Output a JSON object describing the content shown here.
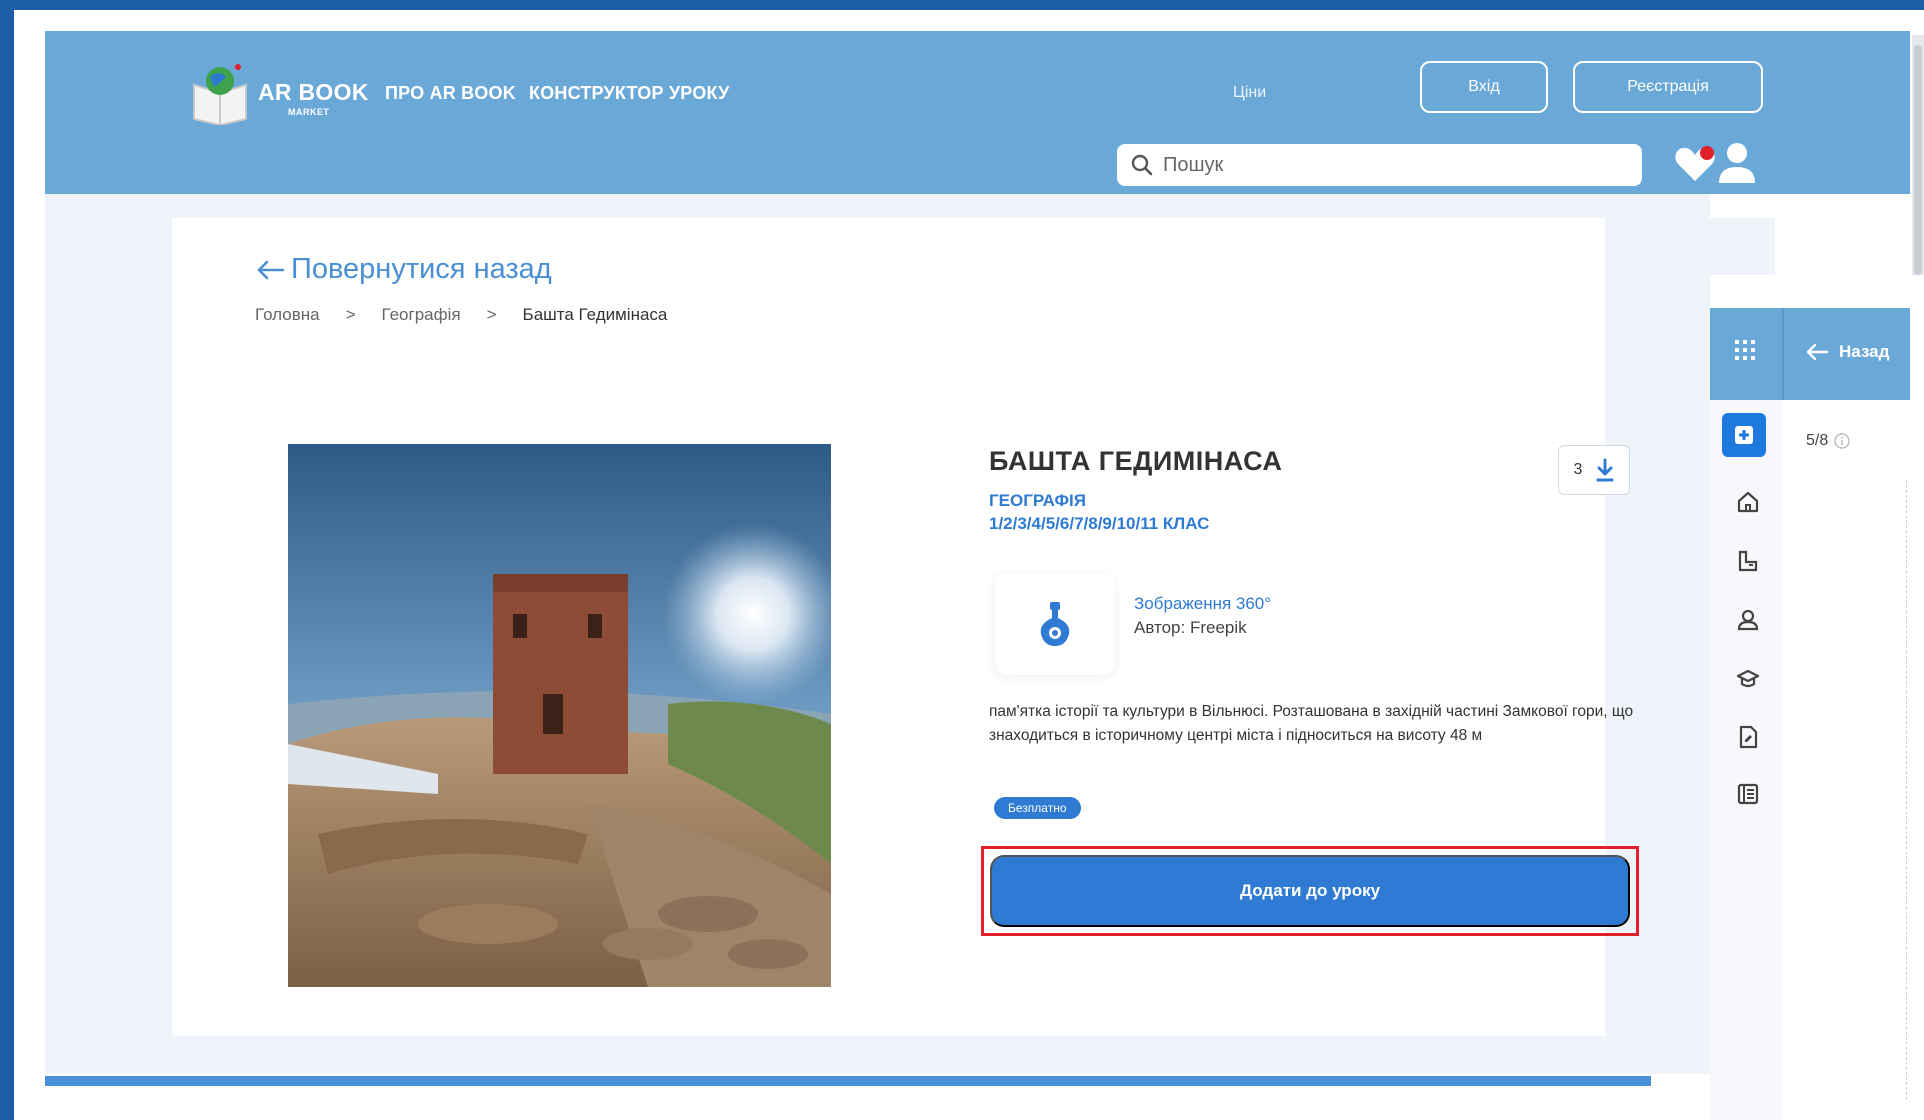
{
  "header": {
    "logo_text": "AR BOOK",
    "logo_sub": "MARKET",
    "nav": [
      "ПРО AR BOOK",
      "КОНСТРУКТОР УРОКУ"
    ],
    "prices_link": "Ціни",
    "login_button": "Вхід",
    "register_button": "Реєстрація",
    "search_placeholder": "Пошук",
    "favorites_badge_color": "#e0202a"
  },
  "page": {
    "back_link": "Повернутися назад",
    "breadcrumb": [
      "Головна",
      "Географія",
      "Башта Гедимінаса"
    ]
  },
  "product": {
    "title": "БАШТА ГЕДИМІНАСА",
    "subject": "ГЕОГРАФІЯ",
    "grades": "1/2/3/4/5/6/7/8/9/10/11 КЛАС",
    "downloads": "3",
    "type_label": "Зображення 360°",
    "author": "Автор: Freepik",
    "description": "пам'ятка історії та культури в Вільнюсі. Розташована в західній частині Замкової гори, що знаходиться в історичному центрі міста і підноситься на висоту 48 м",
    "price_badge": "Безплатно",
    "add_button": "Додати до уроку"
  },
  "side_panel": {
    "back_label": "Назад",
    "count": "5/8"
  },
  "colors": {
    "accent": "#2f7bd3",
    "header": "#6aa8d8",
    "highlight": "#e0202a"
  }
}
